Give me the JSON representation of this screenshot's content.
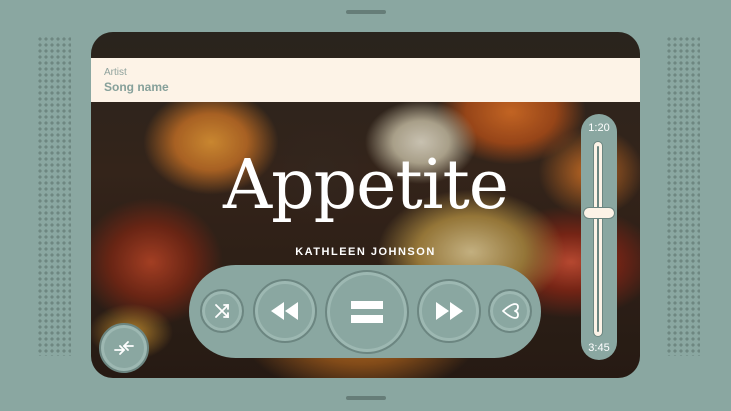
{
  "now_playing": {
    "artist": "Artist",
    "song_name": "Song name",
    "album_title": "Appetite",
    "album_artist": "KATHLEEN JOHNSON"
  },
  "playback": {
    "current_time": "1:20",
    "total_time": "3:45",
    "progress_fraction": 0.356
  },
  "controls": {
    "shuffle_icon": "shuffle-icon",
    "rewind_icon": "rewind-icon",
    "play_pause_icon": "pause-icon",
    "fast_forward_icon": "fast-forward-icon",
    "like_icon": "heart-icon",
    "swap_icon": "swap-arrows-icon"
  },
  "colors": {
    "background": "#8aa7a1",
    "info_bar": "#fdf3e7",
    "icon": "#ffffff",
    "border": "#6c8681"
  }
}
